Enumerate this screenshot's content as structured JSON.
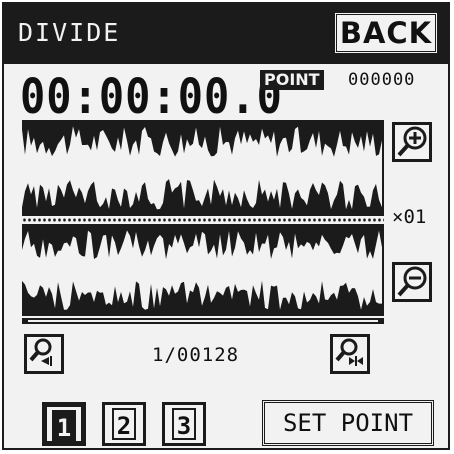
{
  "header": {
    "title": "DIVIDE",
    "back_label": "BACK"
  },
  "time": {
    "timecode": "00:00:00.0",
    "point_label": "POINT",
    "point_value": "000000"
  },
  "zoom": {
    "level": "×01",
    "zoom_in_icon": "magnifier-plus-icon",
    "zoom_out_icon": "magnifier-minus-icon"
  },
  "navigation": {
    "position": "1/00128",
    "start_icon": "magnifier-jump-start-icon",
    "end_icon": "magnifier-jump-end-icon"
  },
  "slots": [
    {
      "label": "1",
      "active": true
    },
    {
      "label": "2",
      "active": false
    },
    {
      "label": "3",
      "active": false
    }
  ],
  "actions": {
    "set_point_label": "SET POINT"
  },
  "colors": {
    "ink": "#1b1b1b",
    "paper": "#f2f2f2"
  }
}
